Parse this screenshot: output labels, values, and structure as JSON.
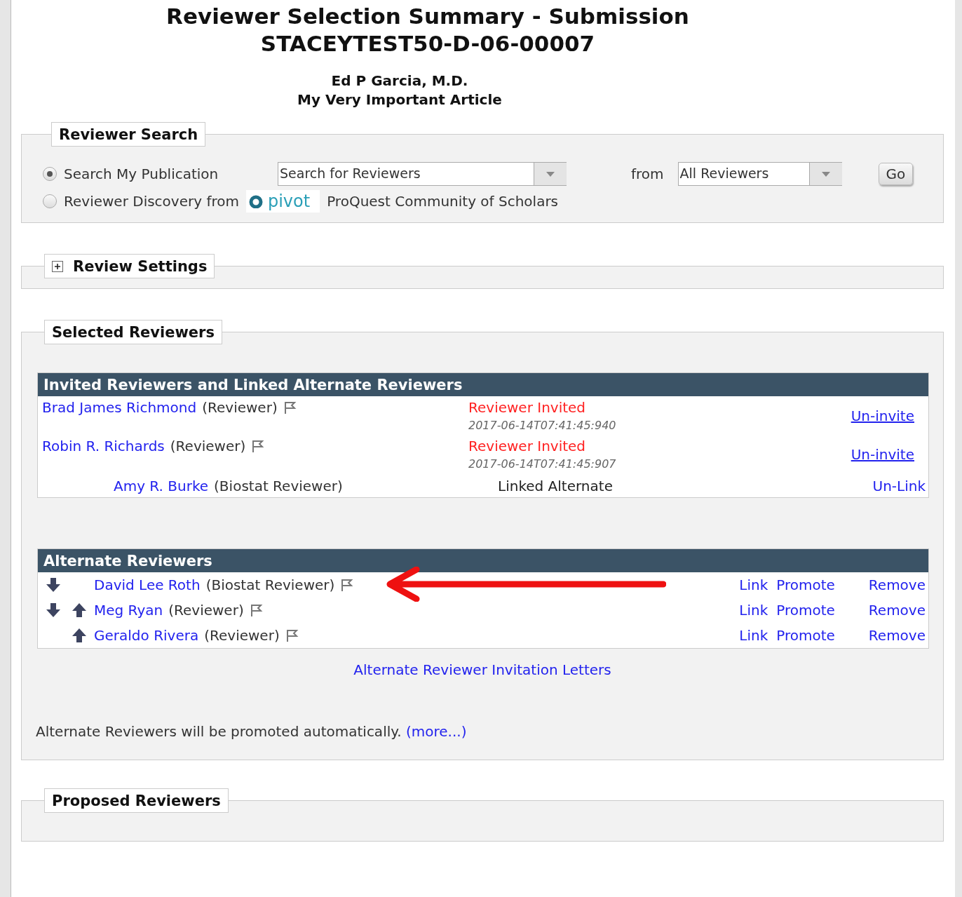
{
  "title_lines": [
    "Reviewer Selection Summary - Submission",
    "STACEYTEST50-D-06-00007"
  ],
  "author": "Ed P Garcia, M.D.",
  "article": "My Very Important Article",
  "reviewer_search": {
    "legend": "Reviewer Search",
    "options": [
      {
        "label": "Search My Publication",
        "selected": true
      },
      {
        "label": "Reviewer Discovery from",
        "selected": false,
        "logo_text": "pivot",
        "suffix": "ProQuest Community of Scholars"
      }
    ],
    "query_select": {
      "value": "Search for Reviewers"
    },
    "from_label": "from",
    "source_select": {
      "value": "All Reviewers"
    },
    "go_button": "Go"
  },
  "review_settings": {
    "legend": "Review Settings",
    "expanded": false
  },
  "selected_reviewers": {
    "legend": "Selected Reviewers",
    "invited": {
      "header": "Invited Reviewers and Linked Alternate Reviewers",
      "rows": [
        {
          "kind": "invited",
          "name": "Brad James Richmond",
          "role": "(Reviewer)",
          "status": "Reviewer Invited",
          "timestamp": "2017-06-14T07:41:45:940",
          "action": "Un-invite"
        },
        {
          "kind": "invited",
          "name": "Robin R. Richards",
          "role": "(Reviewer)",
          "status": "Reviewer Invited",
          "timestamp": "2017-06-14T07:41:45:907",
          "action": "Un-invite"
        },
        {
          "kind": "linked",
          "name": "Amy R. Burke",
          "role": "(Biostat Reviewer)",
          "status": "Linked Alternate",
          "action": "Un-Link"
        }
      ]
    },
    "alternates": {
      "header": "Alternate Reviewers",
      "rows": [
        {
          "name": "David Lee Roth",
          "role": "(Biostat Reviewer)",
          "move_down": true,
          "move_up": false,
          "link": "Link",
          "promote": "Promote",
          "remove": "Remove",
          "annotated": true
        },
        {
          "name": "Meg Ryan",
          "role": "(Reviewer)",
          "move_down": true,
          "move_up": true,
          "link": "Link",
          "promote": "Promote",
          "remove": "Remove",
          "annotated": false
        },
        {
          "name": "Geraldo Rivera",
          "role": "(Reviewer)",
          "move_down": false,
          "move_up": true,
          "link": "Link",
          "promote": "Promote",
          "remove": "Remove",
          "annotated": false
        }
      ]
    },
    "letters_link": "Alternate Reviewer Invitation Letters",
    "note": "Alternate Reviewers will be promoted automatically.",
    "more_link": "(more...)"
  },
  "proposed_reviewers": {
    "legend": "Proposed Reviewers"
  }
}
